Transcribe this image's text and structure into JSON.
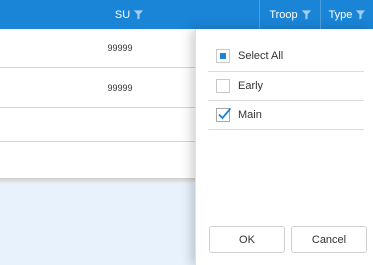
{
  "header": {
    "columns": [
      {
        "label": "SU",
        "icon": "filter-icon"
      },
      {
        "label": "Troop",
        "icon": "filter-icon"
      },
      {
        "label": "Type",
        "icon": "filter-icon"
      }
    ]
  },
  "rows": [
    {
      "su": "99999"
    },
    {
      "su": "99999"
    },
    {
      "su": ""
    },
    {
      "su": ""
    }
  ],
  "filter_popup": {
    "options": [
      {
        "label": "Select All",
        "state": "partial"
      },
      {
        "label": "Early",
        "state": "unchecked"
      },
      {
        "label": "Main",
        "state": "checked"
      }
    ],
    "ok_label": "OK",
    "cancel_label": "Cancel"
  },
  "colors": {
    "header_bg": "#1a84d6",
    "accent": "#1a84d6",
    "empty_area_bg": "#e8f2fd"
  }
}
